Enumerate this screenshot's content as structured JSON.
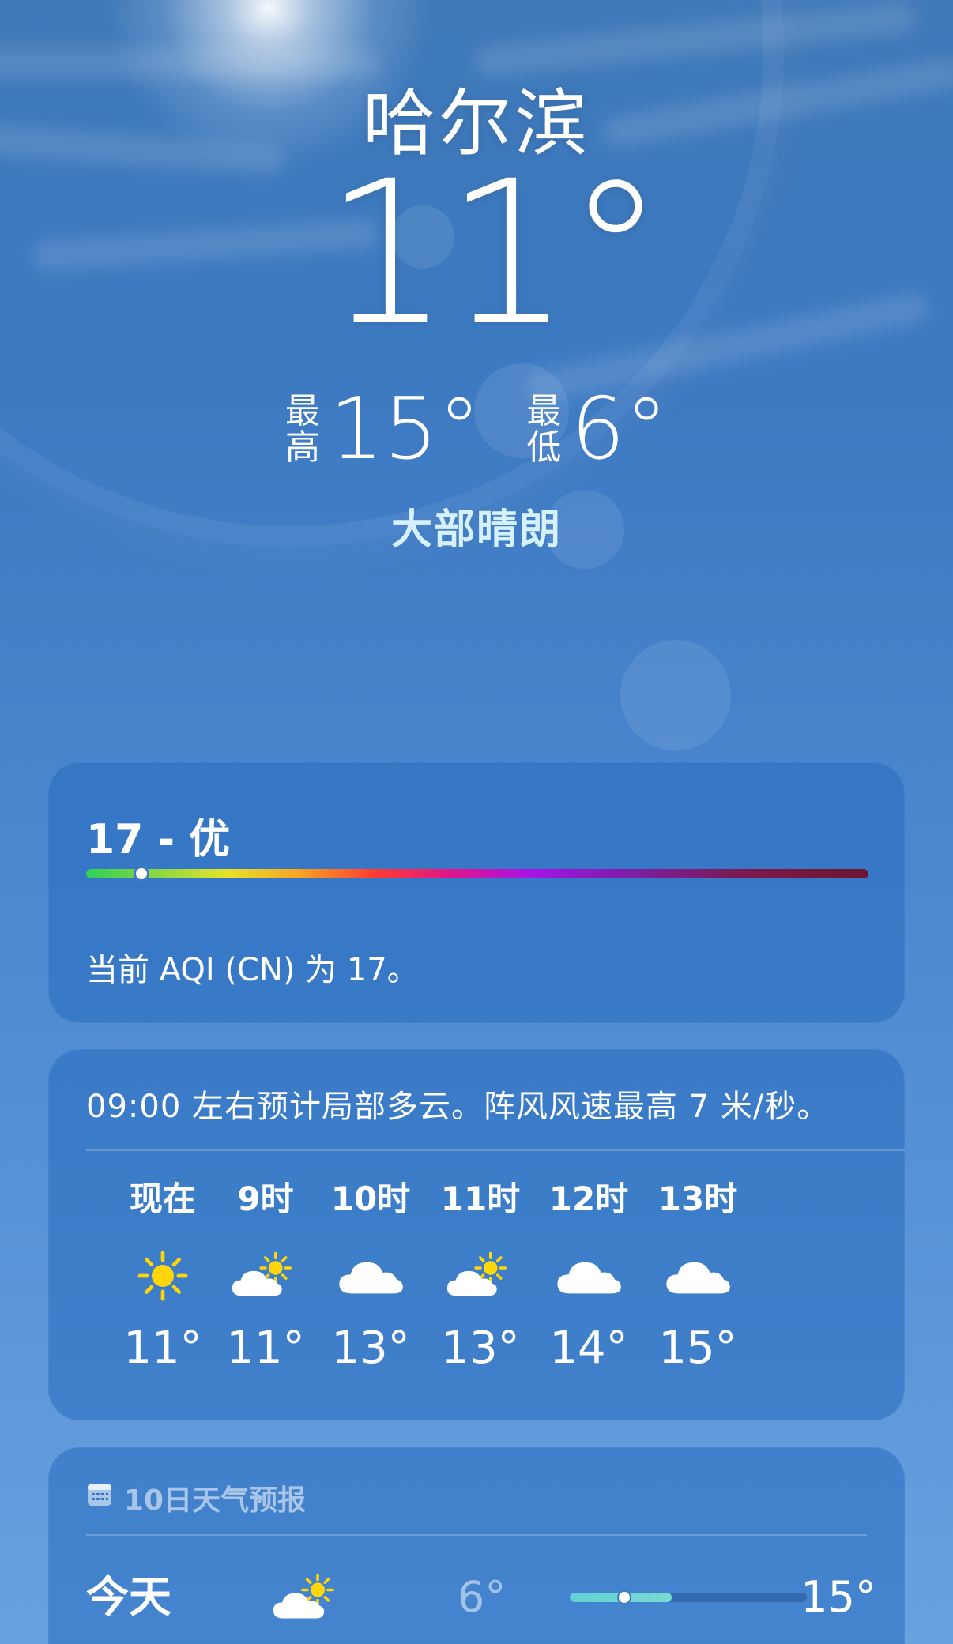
{
  "location": {
    "city": "哈尔滨",
    "current_temp": "11°",
    "high_label": "最高",
    "high_value": "15°",
    "low_label": "最低",
    "low_value": "6°",
    "condition": "大部晴朗"
  },
  "aqi": {
    "title": "17 - 优",
    "value": 17,
    "scale_max": 500,
    "description": "当前 AQI (CN) 为 17。",
    "colors": [
      "#30d158",
      "#e8e22a",
      "#f5a623",
      "#ff3b30",
      "#e0148f",
      "#a514e6",
      "#7b1fa2",
      "#6d1530"
    ]
  },
  "hourly": {
    "summary": "09:00 左右预计局部多云。阵风风速最高 7 米/秒。",
    "items": [
      {
        "label": "现在",
        "icon": "sun-icon",
        "temp": "11°"
      },
      {
        "label": "9时",
        "icon": "partly-cloudy-icon",
        "temp": "11°"
      },
      {
        "label": "10时",
        "icon": "cloud-icon",
        "temp": "13°"
      },
      {
        "label": "11时",
        "icon": "partly-cloudy-icon",
        "temp": "13°"
      },
      {
        "label": "12时",
        "icon": "cloud-icon",
        "temp": "14°"
      },
      {
        "label": "13时",
        "icon": "cloud-icon",
        "temp": "15°"
      }
    ]
  },
  "daily": {
    "header": "10日天气预报",
    "header_icon": "calendar-icon",
    "days": [
      {
        "name": "今天",
        "icon": "partly-cloudy-icon",
        "low": "6°",
        "high": "15°",
        "range_start": 0.0,
        "range_end": 0.43,
        "current_pos": 0.23
      }
    ]
  },
  "colors": {
    "condition_text": "#d6f1ff",
    "sun": "#ffd60a",
    "day_bar": "#62d1d6"
  }
}
